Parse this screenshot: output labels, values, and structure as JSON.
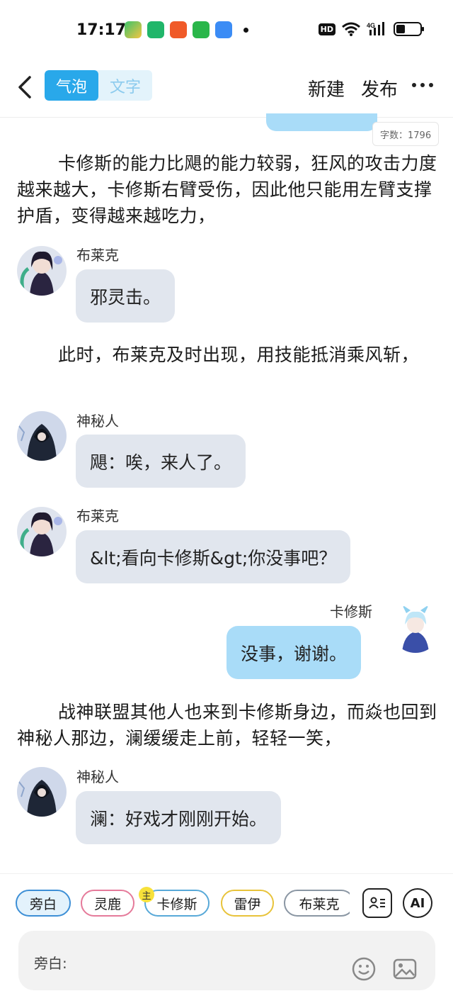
{
  "status_bar": {
    "time": "17:17",
    "hd": "HD",
    "network": "4G"
  },
  "header": {
    "tab_bubble": "气泡",
    "tab_text": "文字",
    "new_label": "新建",
    "publish_label": "发布"
  },
  "word_count": "字数：1796",
  "narrations": [
    "卡修斯的能力比飓的能力较弱，狂风的攻击力度越来越大，卡修斯右臂受伤，因此他只能用左臂支撑护盾，变得越来越吃力，",
    "此时，布莱克及时出现，用技能抵消乘风斩，",
    "战神联盟其他人也来到卡修斯身边，而焱也回到神秘人那边，澜缓缓走上前，轻轻一笑，"
  ],
  "messages": [
    {
      "name": "布莱克",
      "text": "邪灵击。"
    },
    {
      "name": "神秘人",
      "text": "飓：唉，来人了。"
    },
    {
      "name": "布莱克",
      "text": "&lt;看向卡修斯&gt;你没事吧？"
    },
    {
      "name": "卡修斯",
      "text": "没事，谢谢。"
    },
    {
      "name": "神秘人",
      "text": "澜：好戏才刚刚开始。"
    }
  ],
  "characters": [
    "旁白",
    "灵鹿",
    "卡修斯",
    "雷伊",
    "布莱克"
  ],
  "main_badge": "主",
  "ai_label": "AI",
  "input_label": "旁白:",
  "colors": {
    "accent": "#29a8ea",
    "bubble_right": "#a9dcf8",
    "bubble_left": "#e1e6ee",
    "chip_pangbai": "#3d8fd6",
    "chip_linglu": "#e57a9a",
    "chip_kaxiusi": "#58a9d8",
    "chip_leiyi": "#e8c33a",
    "chip_bulaike": "#8a96a3"
  }
}
